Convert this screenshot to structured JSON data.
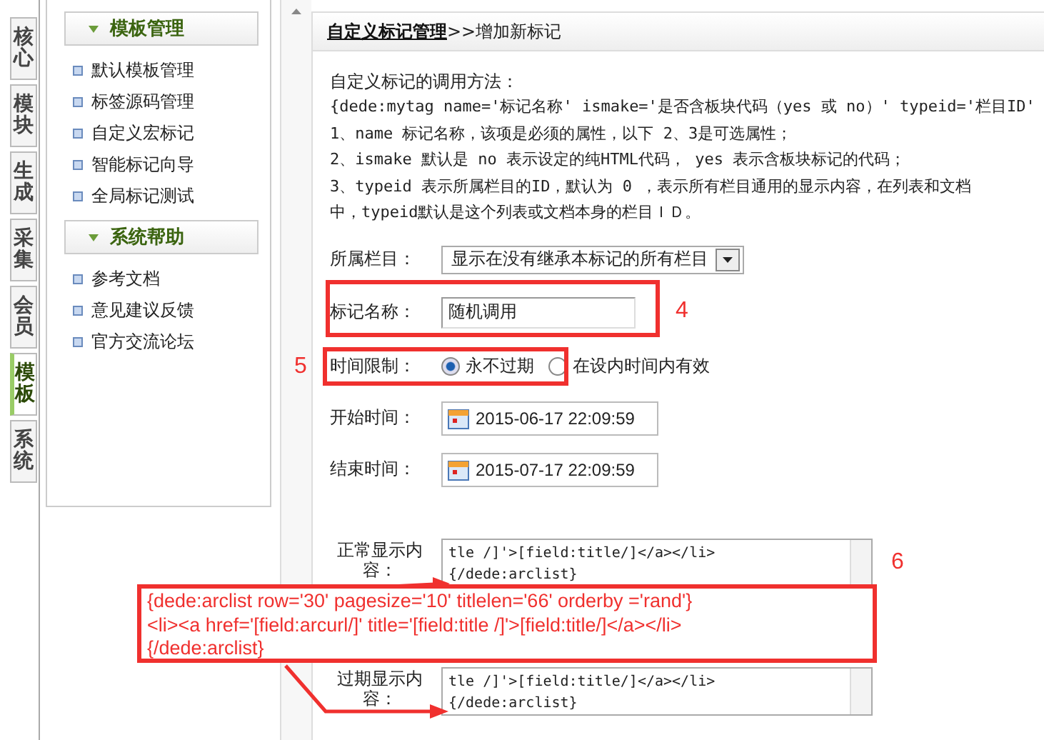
{
  "side_tabs": [
    {
      "label": "核心",
      "selected": false
    },
    {
      "label": "模块",
      "selected": false
    },
    {
      "label": "生成",
      "selected": false
    },
    {
      "label": "采集",
      "selected": false
    },
    {
      "label": "会员",
      "selected": false
    },
    {
      "label": "模板",
      "selected": true
    },
    {
      "label": "系统",
      "selected": false
    }
  ],
  "menu": [
    {
      "title": "模板管理",
      "items": [
        "默认模板管理",
        "标签源码管理",
        "自定义宏标记",
        "智能标记向导",
        "全局标记测试"
      ]
    },
    {
      "title": "系统帮助",
      "items": [
        "参考文档",
        "意见建议反馈",
        "官方交流论坛"
      ]
    }
  ],
  "breadcrumb": {
    "link": "自定义标记管理",
    "rest": ">>增加新标记"
  },
  "help": {
    "title": "自定义标记的调用方法：",
    "lines": [
      "{dede:mytag name='标记名称' ismake='是否含板块代码（yes 或 no）' typeid='栏目ID'",
      "1、name 标记名称，该项是必须的属性，以下 2、3是可选属性；",
      "2、ismake 默认是 no 表示设定的纯HTML代码， yes 表示含板块标记的代码；",
      "3、typeid 表示所属栏目的ID，默认为 0 ，表示所有栏目通用的显示内容，在列表和文档",
      "中，typeid默认是这个列表或文档本身的栏目ＩＤ。"
    ]
  },
  "form": [
    {
      "kind": "select",
      "label": "所属栏目：",
      "value": "显示在没有继承本标记的所有栏目"
    },
    {
      "kind": "text",
      "label": "标记名称：",
      "value": "随机调用"
    },
    {
      "kind": "radio",
      "label": "时间限制：",
      "options": [
        {
          "label": "永不过期",
          "selected": true
        },
        {
          "label": "在设内时间内有效",
          "selected": false
        }
      ]
    },
    {
      "kind": "date",
      "label": "开始时间：",
      "value": "2015-06-17 22:09:59"
    },
    {
      "kind": "date",
      "label": "结束时间：",
      "value": "2015-07-17 22:09:59"
    },
    {
      "kind": "textarea",
      "label": "正常显示内容：",
      "lines": [
        "tle /]'>[field:title/]</a></li>",
        "{/dede:arclist}"
      ]
    },
    {
      "kind": "textarea",
      "label": "过期显示内容：",
      "lines": [
        "tle /]'>[field:title/]</a></li>",
        "{/dede:arclist}"
      ]
    }
  ],
  "annotations": {
    "numbers": [
      "4",
      "5",
      "6"
    ],
    "callout": [
      "{dede:arclist row='30' pagesize='10' titlelen='66' orderby ='rand'}",
      "<li><a href='[field:arcurl/]' title='[field:title /]'>[field:title/]</a></li>",
      "{/dede:arclist}"
    ]
  }
}
